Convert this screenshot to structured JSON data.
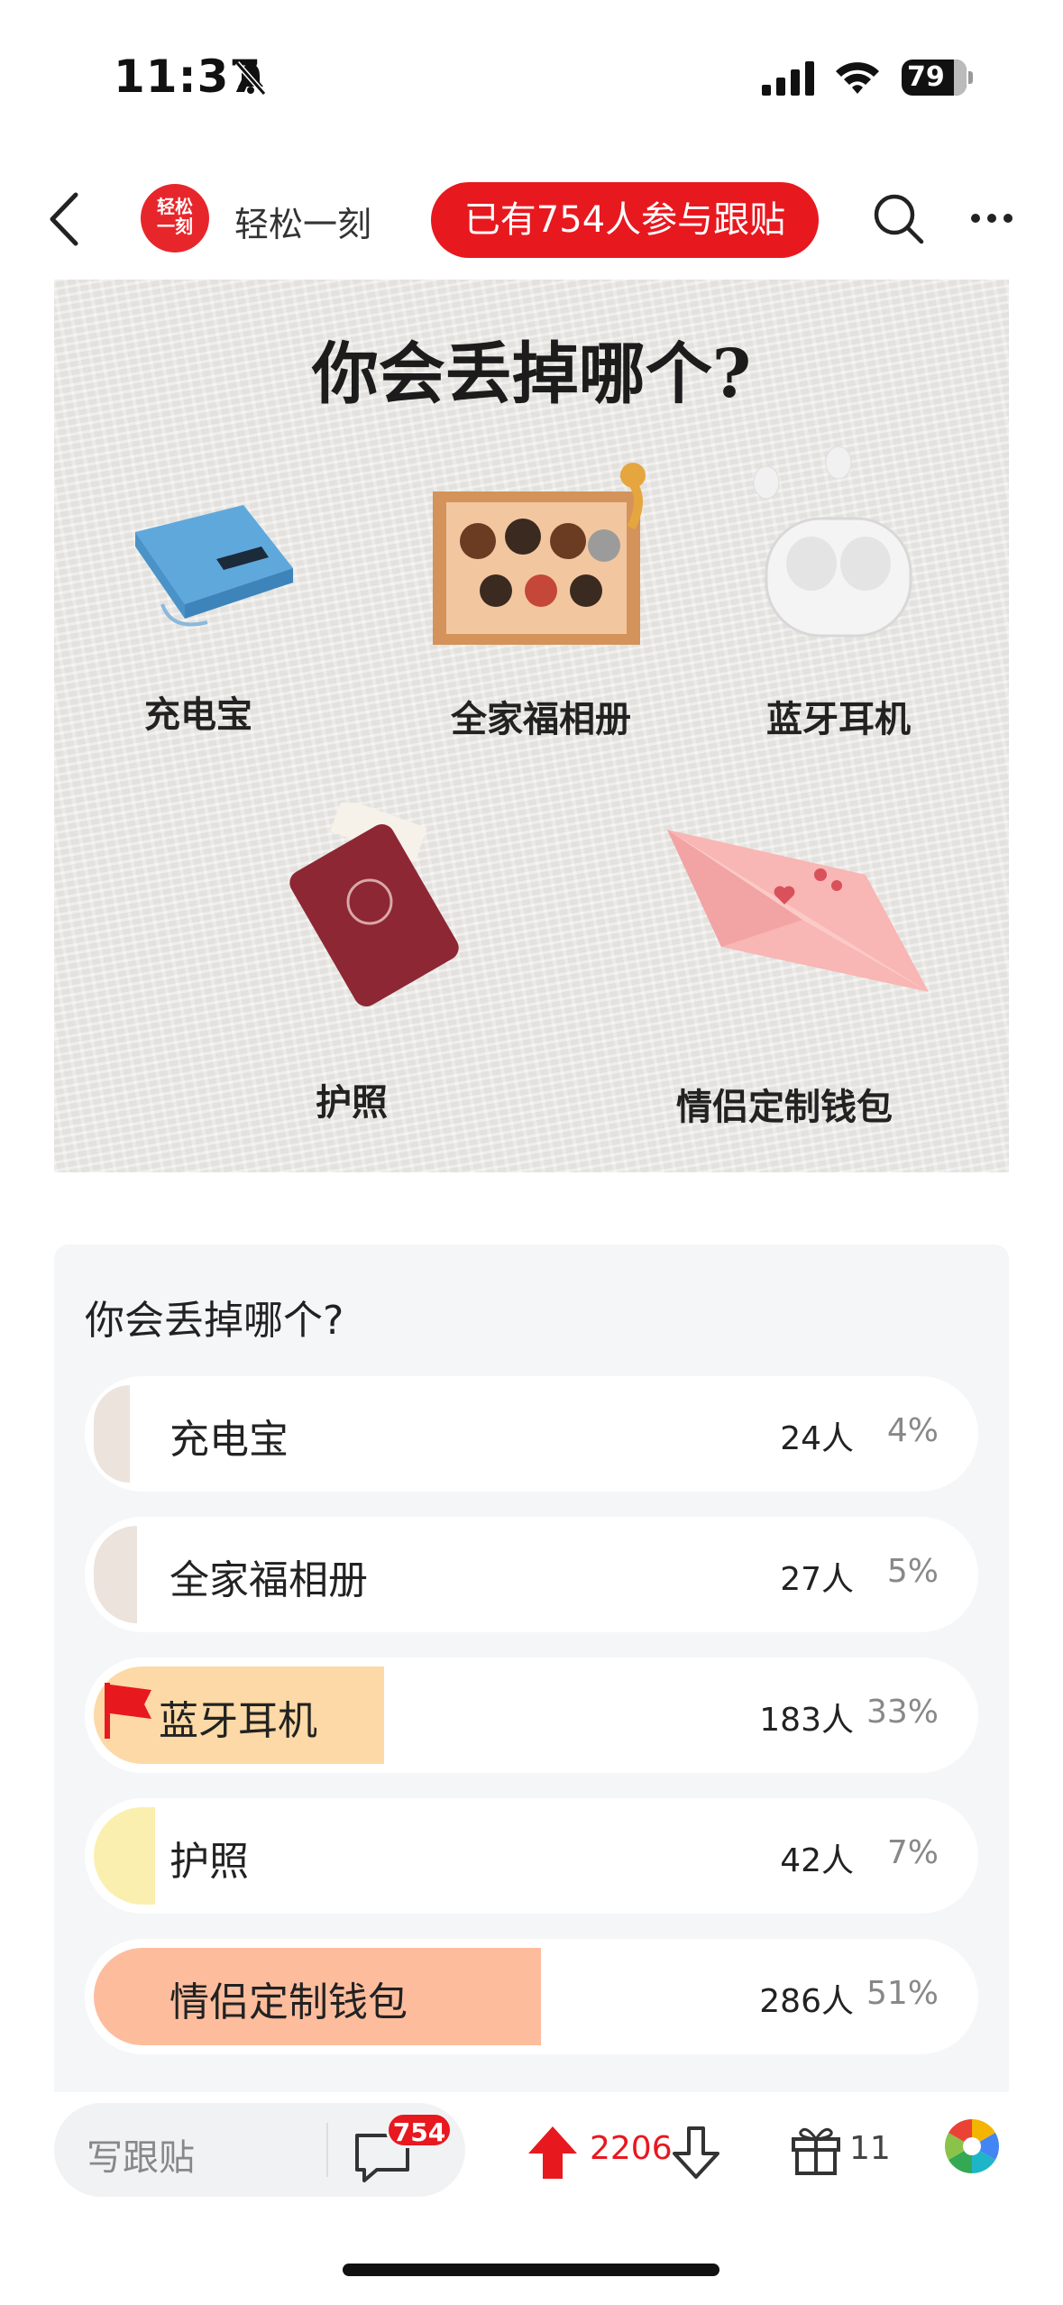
{
  "status_bar": {
    "time": "11:37",
    "battery": "79"
  },
  "header": {
    "avatar_text_line1": "轻松",
    "avatar_text_line2": "一刻",
    "channel_name": "轻松一刻",
    "join_pill": "已有754人参与跟贴"
  },
  "poster": {
    "title": "你会丢掉哪个?",
    "items": [
      {
        "label": "充电宝",
        "icon": "power-bank"
      },
      {
        "label": "全家福相册",
        "icon": "family-photo"
      },
      {
        "label": "蓝牙耳机",
        "icon": "earbuds"
      },
      {
        "label": "护照",
        "icon": "passport"
      },
      {
        "label": "情侣定制钱包",
        "icon": "love-envelope"
      }
    ]
  },
  "poll": {
    "title": "你会丢掉哪个?",
    "options": [
      {
        "label": "充电宝",
        "count": "24人",
        "percent": "4%",
        "fraction": 0.04,
        "color": "#ece3dd"
      },
      {
        "label": "全家福相册",
        "count": "27人",
        "percent": "5%",
        "fraction": 0.05,
        "color": "#ece3dd"
      },
      {
        "label": "蓝牙耳机",
        "count": "183人",
        "percent": "33%",
        "fraction": 0.33,
        "color": "#fcd9a6",
        "selected": true
      },
      {
        "label": "护照",
        "count": "42人",
        "percent": "7%",
        "fraction": 0.07,
        "color": "#fbefb0"
      },
      {
        "label": "情侣定制钱包",
        "count": "286人",
        "percent": "51%",
        "fraction": 0.51,
        "color": "#fdbd9d"
      }
    ]
  },
  "bottom_bar": {
    "comment_placeholder": "写跟贴",
    "comment_badge": "754",
    "upvotes": "2206",
    "gifts": "11"
  },
  "colors": {
    "accent": "#e8181f"
  }
}
